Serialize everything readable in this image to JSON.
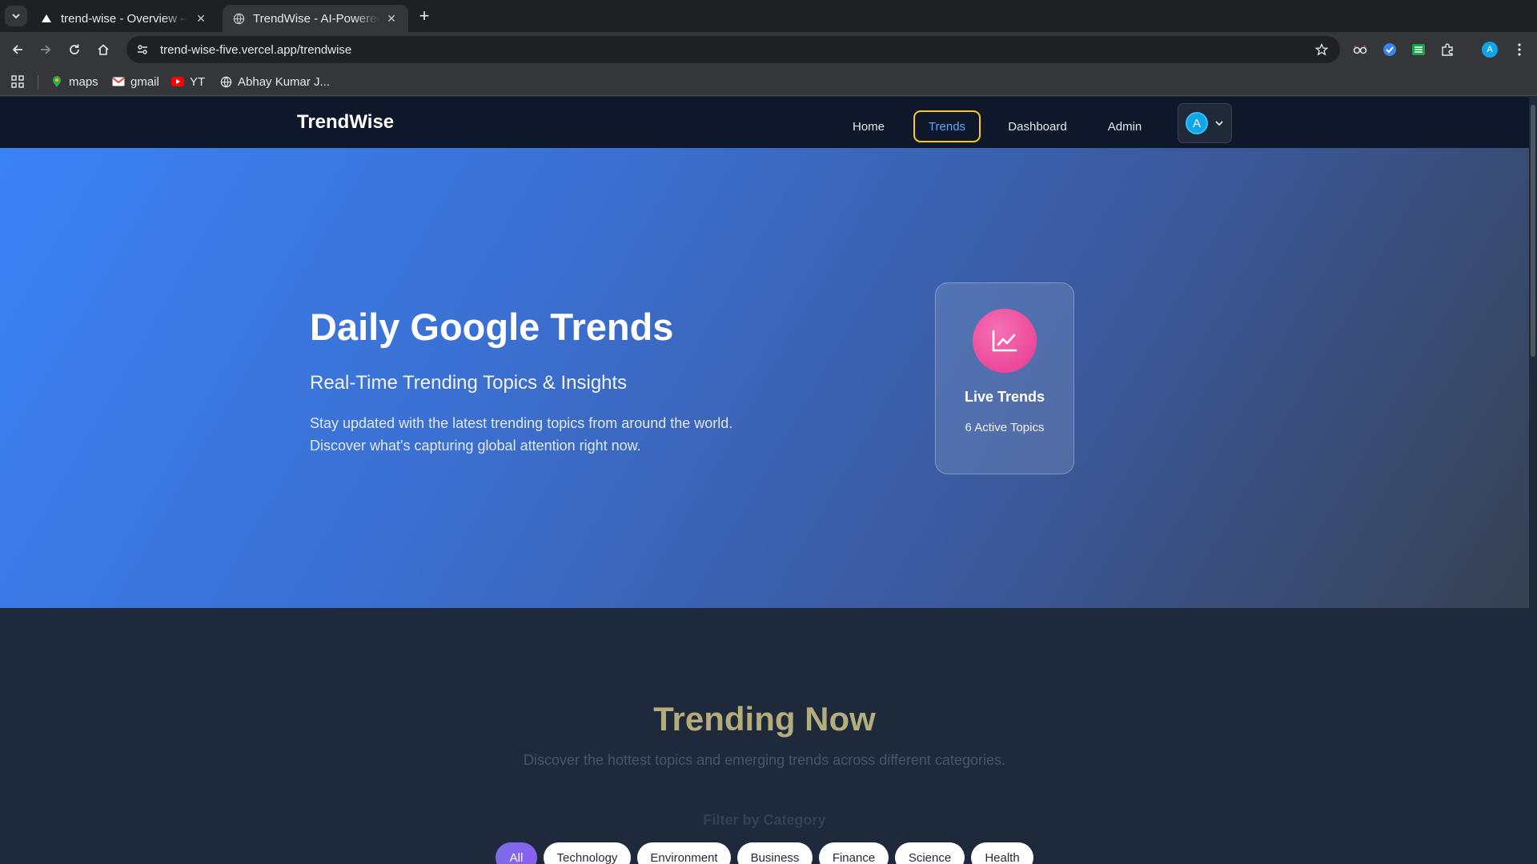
{
  "browser": {
    "tabs": [
      {
        "title": "trend-wise - Overview – Vercel",
        "active": false
      },
      {
        "title": "TrendWise - AI-Powered Trends",
        "active": true
      }
    ],
    "url": "trend-wise-five.vercel.app/trendwise",
    "bookmarks": [
      {
        "label": "maps",
        "icon": "maps-pin-icon"
      },
      {
        "label": "gmail",
        "icon": "gmail-icon"
      },
      {
        "label": "YT",
        "icon": "youtube-icon"
      },
      {
        "label": "Abhay Kumar J...",
        "icon": "globe-icon"
      }
    ],
    "profile_initial": "A"
  },
  "nav": {
    "brand": "TrendWise",
    "links": [
      {
        "label": "Home",
        "active": false
      },
      {
        "label": "Trends",
        "active": true
      },
      {
        "label": "Dashboard",
        "active": false
      },
      {
        "label": "Admin",
        "active": false
      }
    ],
    "user_initial": "A"
  },
  "hero": {
    "title": "Daily Google Trends",
    "subtitle": "Real-Time Trending Topics & Insights",
    "description_line1": "Stay updated with the latest trending topics from around the world.",
    "description_line2": "Discover what's capturing global attention right now.",
    "card": {
      "icon": "chart-line-icon",
      "title": "Live Trends",
      "count_text": "6 Active Topics"
    }
  },
  "trending": {
    "title": "Trending Now",
    "subtitle": "Discover the hottest topics and emerging trends across different categories.",
    "filter_label": "Filter by Category",
    "categories": [
      "All",
      "Technology",
      "Environment",
      "Business",
      "Finance",
      "Science",
      "Health"
    ],
    "selected": "All"
  },
  "colors": {
    "accent": "#3b82f6",
    "active_ring": "#facc15",
    "chip_active": "#8b5cf6",
    "live_icon": "#ec4899"
  }
}
